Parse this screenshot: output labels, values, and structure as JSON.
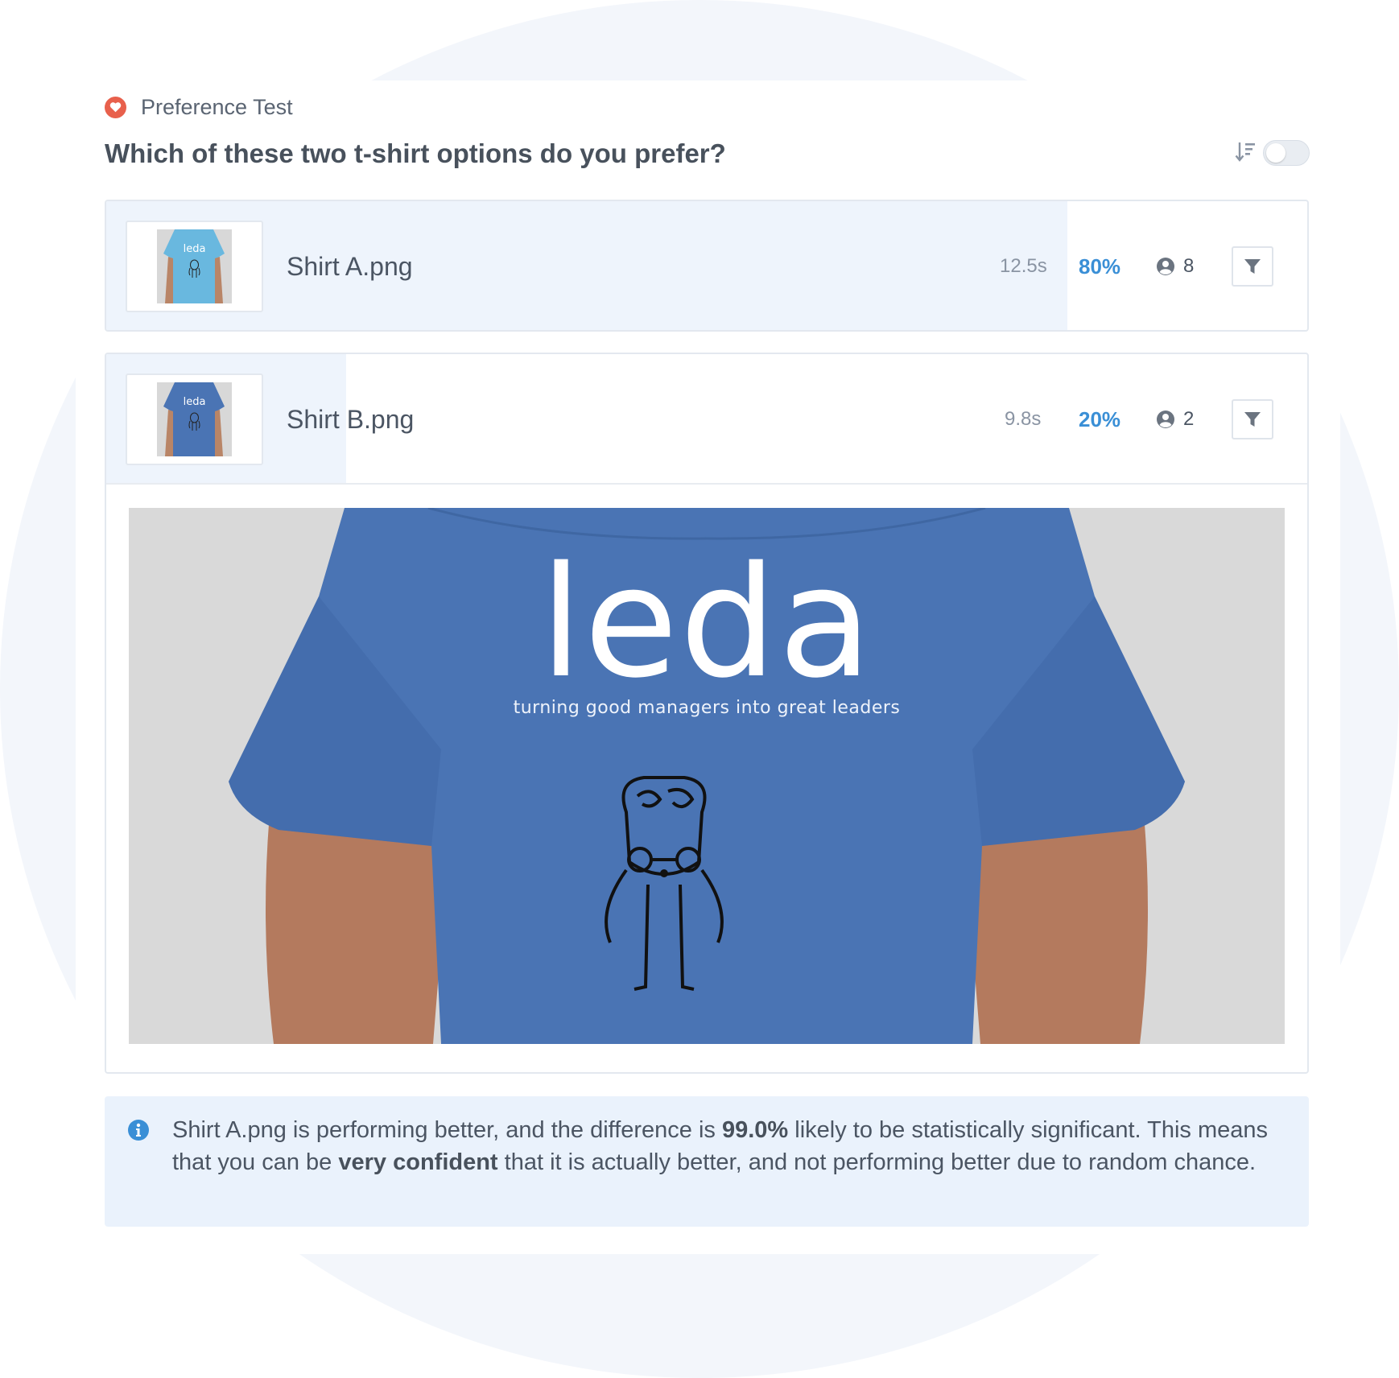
{
  "header": {
    "test_type": "Preference Test",
    "question": "Which of these two t-shirt options do you prefer?"
  },
  "colors": {
    "accent_blue": "#3a8fd6",
    "heart_red": "#e8604c",
    "bar_fill": "#eef4fc",
    "info_bg": "#eaf2fc"
  },
  "options": [
    {
      "file_name": "Shirt A.png",
      "avg_time": "12.5s",
      "percent": "80%",
      "share": 0.8,
      "users": "8",
      "shirt_color": "#69b8df",
      "thumb_text": "leda"
    },
    {
      "file_name": "Shirt B.png",
      "avg_time": "9.8s",
      "percent": "20%",
      "share": 0.2,
      "users": "2",
      "shirt_color": "#4a74b4",
      "thumb_text": "leda"
    }
  ],
  "preview": {
    "logo_text": "leda",
    "tagline": "turning good managers into great leaders",
    "shirt_color": "#4a74b4"
  },
  "insight": {
    "part1": "Shirt A.png is performing better, and the difference is ",
    "significance": "99.0%",
    "part2": " likely to be statistically significant. This means that you can be ",
    "confidence": "very confident",
    "part3": " that it is actually better, and not performing better due to random chance."
  },
  "icons": {
    "header": "heart-icon",
    "sort": "sort-icon",
    "users": "user-circle-icon",
    "filter": "filter-icon",
    "info": "info-circle-icon"
  }
}
